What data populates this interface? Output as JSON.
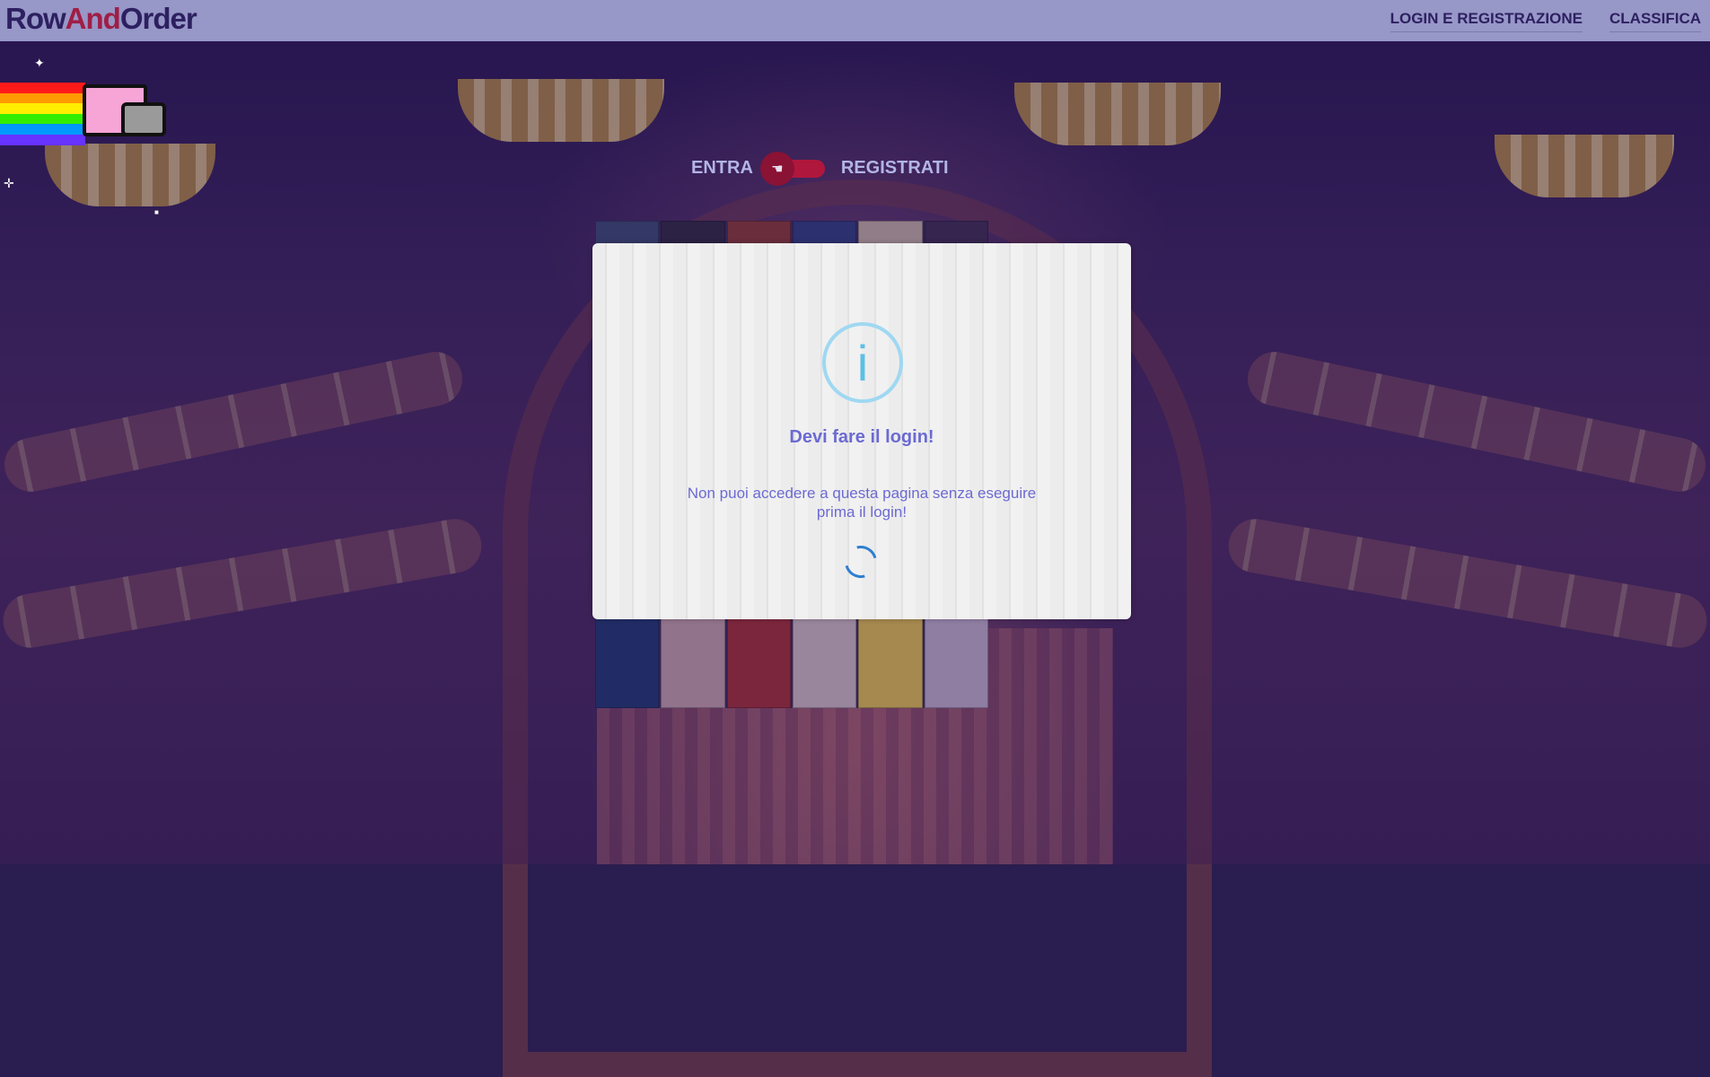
{
  "header": {
    "logo": {
      "part1": "Row",
      "part2": "And",
      "part3": "Order"
    },
    "nav": [
      {
        "label": "LOGIN E REGISTRAZIONE"
      },
      {
        "label": "CLASSIFICA"
      }
    ]
  },
  "auth_toggle": {
    "left_label": "ENTRA",
    "right_label": "REGISTRATI",
    "knob_icon": "pointing-hand-icon",
    "knob_glyph": "☚"
  },
  "modal": {
    "icon": "info-icon",
    "icon_glyph": "i",
    "title": "Devi fare il login!",
    "message": "Non puoi accedere a questa pagina senza eseguire prima il login!",
    "spinner": "loading-spinner"
  },
  "poster_colors": [
    "#3b4c6e",
    "#2d2a3a",
    "#8e3b2d",
    "#2f3f7a",
    "#c9b6a0",
    "#3c2e4a",
    "#6a3e2c",
    "#4a5b7e",
    "#a8865a",
    "#2c2340",
    "#7c2e3a",
    "#5f6a8a",
    "#3a5a8c",
    "#b97c46",
    "#222b4e",
    "#5b4a36",
    "#7e8aa4",
    "#2e3d6b",
    "#3f5d9a",
    "#8a5a3a",
    "#2d3f86",
    "#312a2c",
    "#6c7ea0",
    "#1f2d5a",
    "#1e3a6e",
    "#c9a6a6",
    "#a8302e",
    "#d6c4c0",
    "#e9c84a",
    "#c7b7c9"
  ],
  "colors": {
    "header_bg": "#9797c8",
    "brand_dark": "#2d2060",
    "brand_accent": "#a01e45",
    "modal_text": "#6c6ad2",
    "info_blue": "#5bc0e8",
    "toggle_red": "#b0173c"
  }
}
